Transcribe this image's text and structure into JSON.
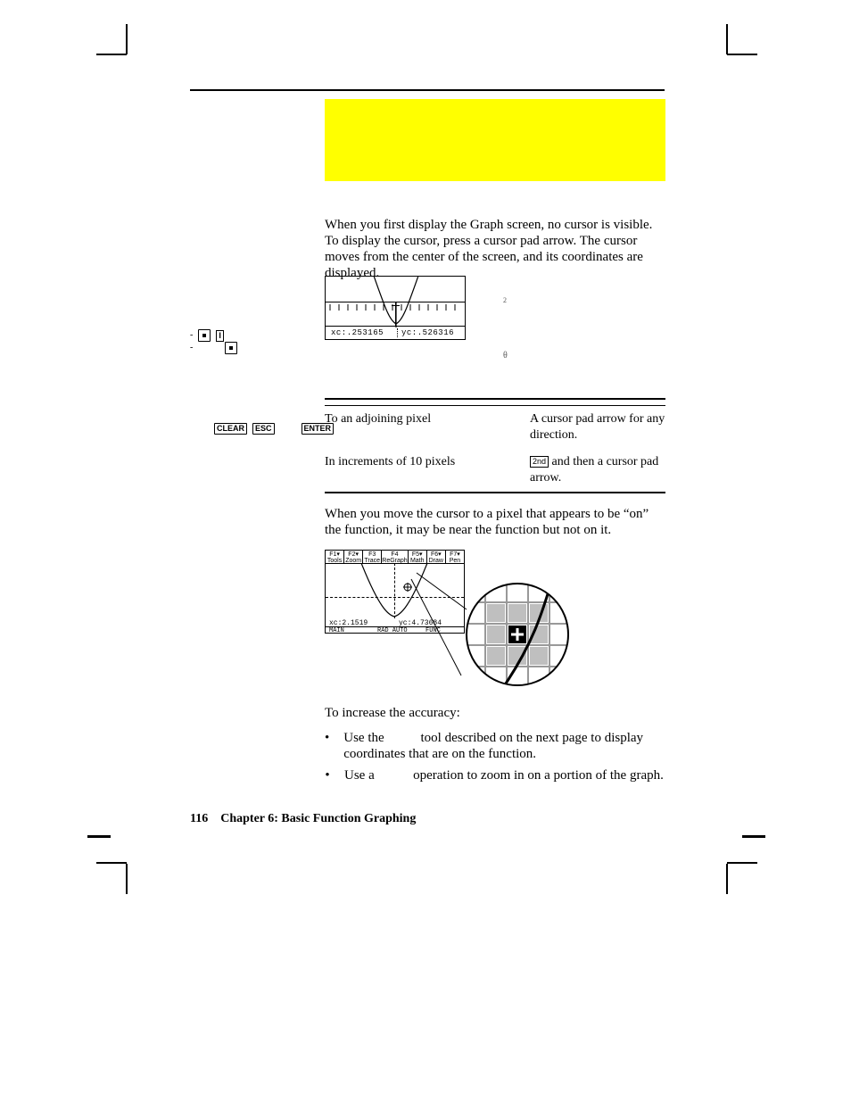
{
  "intro": {
    "text": "When you first display the Graph screen, no cursor is visible. To display the cursor, press a cursor pad arrow. The cursor moves from the center of the screen, and its coordinates are displayed."
  },
  "shot1": {
    "xc": "xc:.253165",
    "yc": "yc:.526316"
  },
  "annotations": {
    "a1_pre": "",
    "a1_fn": "",
    "a1_sup": "2",
    "a2_pre": "",
    "a2_theta": "θ",
    "a2_post": ""
  },
  "tips": {
    "line1_pre": "-",
    "key_i": "I",
    "line2_pre": "-"
  },
  "keys": {
    "clear": "CLEAR",
    "esc": "ESC",
    "enter": "ENTER",
    "second": "2nd"
  },
  "table": {
    "head": {
      "c1": "",
      "c2": ""
    },
    "rows": [
      {
        "c1": "To an adjoining pixel",
        "c2": "A cursor pad arrow for any direction."
      },
      {
        "c1": "In increments of 10 pixels",
        "c2": " and then a cursor pad arrow."
      }
    ]
  },
  "body2": {
    "text": "When you move the cursor to a pixel that appears to be “on” the function, it may be near the function but not on it."
  },
  "shot2": {
    "toolbar": [
      "F1▾\nTools",
      "F2▾\nZoom",
      "F3\nTrace",
      "F4\nReGraph",
      "F5▾\nMath",
      "F6▾\nDraw",
      "F7▾\nPen"
    ],
    "xc": "xc:2.1519",
    "yc": "yc:4.73684",
    "status": [
      "MAIN",
      "RAD AUTO",
      "FUNC"
    ]
  },
  "accuracy": {
    "lead": "To increase the accuracy:"
  },
  "bullets": [
    {
      "pre": "Use the",
      "post": "tool described on the next page to display coordinates that are on the function."
    },
    {
      "pre": "Use a",
      "post": "operation to zoom in on a portion of the graph."
    }
  ],
  "footer": {
    "page": "116",
    "chapter": "Chapter 6: Basic Function Graphing"
  }
}
